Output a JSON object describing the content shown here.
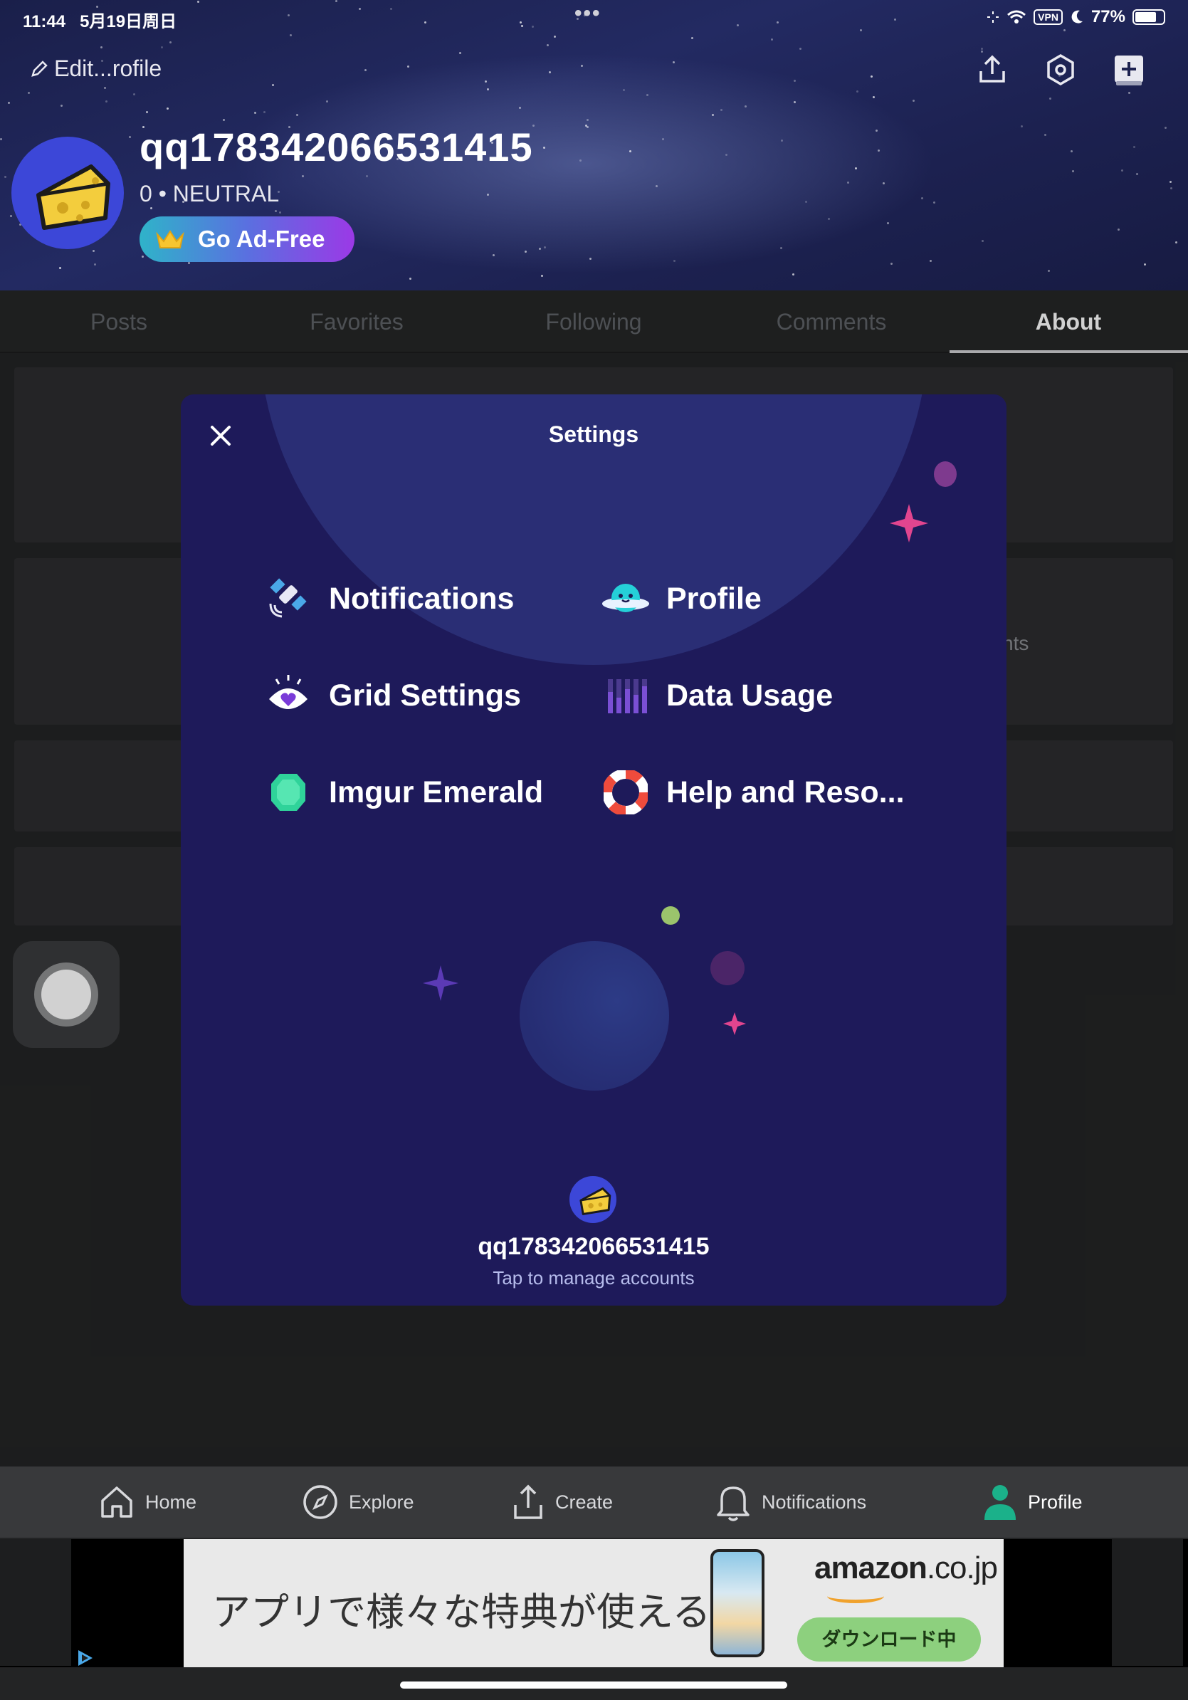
{
  "status_bar": {
    "time": "11:44",
    "date": "5月19日周日",
    "dots": "•••",
    "vpn": "VPN",
    "battery": "77%"
  },
  "header": {
    "edit_profile": "Edit...rofile",
    "icons": [
      "share-icon",
      "settings-hex-icon",
      "add-post-icon"
    ],
    "username": "qq178342066531415",
    "reputation": "0 • NEUTRAL",
    "ad_free_label": "Go Ad-Free"
  },
  "tabs": [
    {
      "label": "Posts"
    },
    {
      "label": "Favorites"
    },
    {
      "label": "Following"
    },
    {
      "label": "Comments"
    },
    {
      "label": "About",
      "active": true
    }
  ],
  "background": {
    "card_fragment": "nts"
  },
  "settings_modal": {
    "title": "Settings",
    "items": [
      {
        "label": "Notifications",
        "icon": "satellite-icon"
      },
      {
        "label": "Profile",
        "icon": "planet-face-icon"
      },
      {
        "label": "Grid Settings",
        "icon": "eye-heart-icon"
      },
      {
        "label": "Data Usage",
        "icon": "bars-icon"
      },
      {
        "label": "Imgur Emerald",
        "icon": "emerald-icon"
      },
      {
        "label": "Help and Reso...",
        "icon": "lifebuoy-icon"
      }
    ],
    "account_name": "qq178342066531415",
    "account_sub": "Tap to manage accounts"
  },
  "bottom_nav": [
    {
      "label": "Home",
      "icon": "home-icon"
    },
    {
      "label": "Explore",
      "icon": "compass-icon"
    },
    {
      "label": "Create",
      "icon": "upload-icon"
    },
    {
      "label": "Notifications",
      "icon": "bell-icon"
    },
    {
      "label": "Profile",
      "icon": "person-icon",
      "color": "#1bb18a"
    }
  ],
  "ad": {
    "headline": "アプリで様々な特典が使える",
    "brand": "amazon",
    "brand_suffix": ".co.jp",
    "button": "ダウンロード中"
  },
  "colors": {
    "modal_bg": "#1e1a5a",
    "header_gradient_start": "#2fb3c9",
    "header_gradient_end": "#9b39e6",
    "active_profile": "#1bb18a"
  }
}
